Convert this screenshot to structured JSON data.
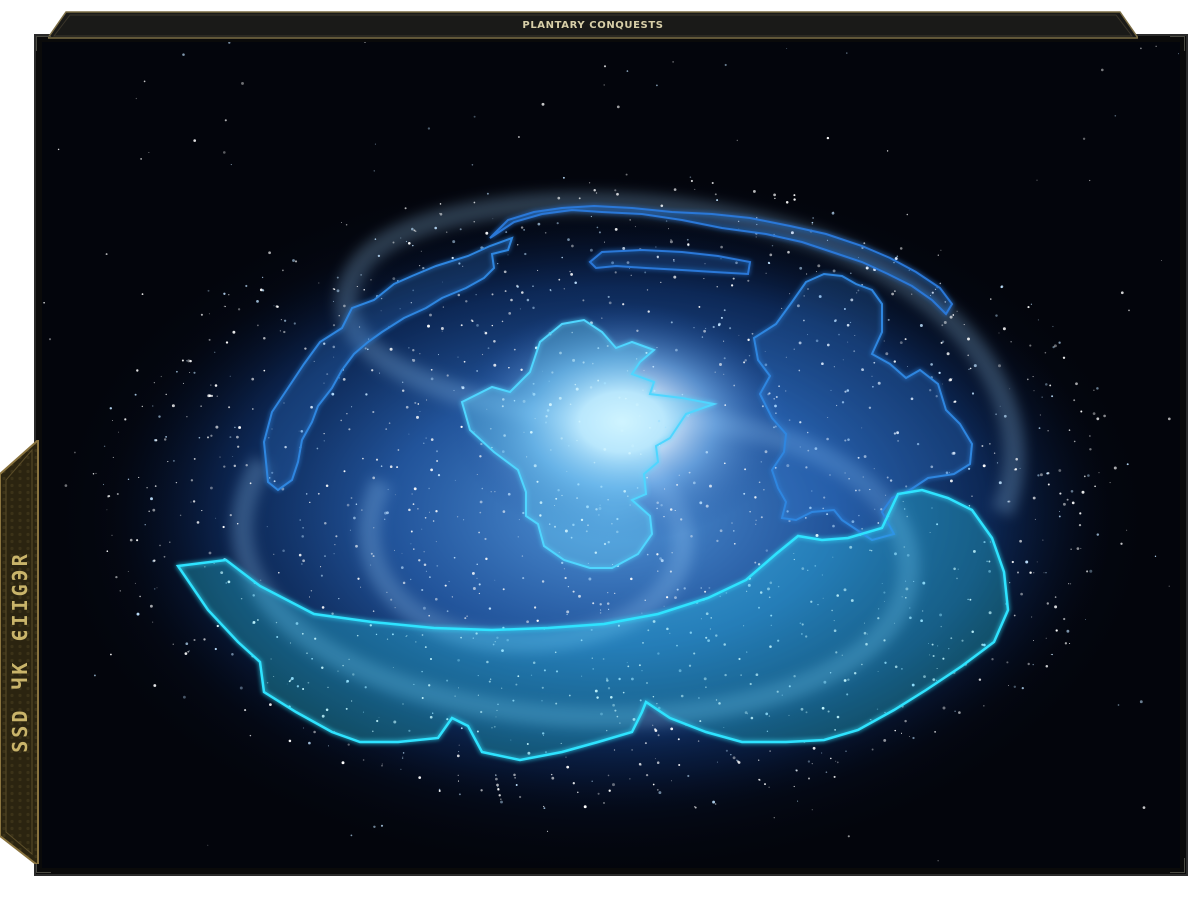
{
  "window": {
    "title": "PLANTARY CONQUESTS"
  },
  "side_panel": {
    "label_parts": [
      "SSD",
      "ЧК",
      "ЄIIGЭR"
    ]
  },
  "map": {
    "name": "galaxy-map",
    "regions": [
      {
        "id": "core",
        "color": "#4fd6ff"
      },
      {
        "id": "inner-rim",
        "color": "#2f86e0"
      },
      {
        "id": "northern-arc",
        "color": "#2a78d8"
      },
      {
        "id": "eastern-territory",
        "color": "#2f86e0"
      },
      {
        "id": "southern-arc",
        "color": "#2fe3ff"
      }
    ]
  },
  "colors": {
    "frame": "#0a0a0a",
    "gold": "#c9b46a",
    "space": "#03050c",
    "galaxy_glow": "#8fd0ff"
  }
}
